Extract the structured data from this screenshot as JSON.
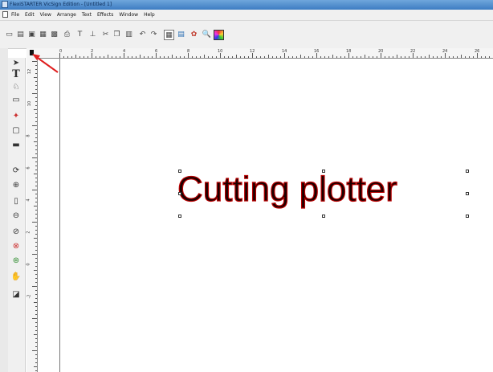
{
  "window": {
    "title": "FlexiSTARTER VicSign Edition - [Untitled 1]"
  },
  "menu": {
    "items": [
      "File",
      "Edit",
      "View",
      "Arrange",
      "Text",
      "Effects",
      "Window",
      "Help"
    ]
  },
  "toolbar": {
    "buttons": [
      "new-icon",
      "open-icon",
      "save-icon",
      "save-as-icon",
      "import-icon",
      "print-icon",
      "text-tool-icon",
      "stamp-icon",
      "cut-icon",
      "copy-icon",
      "paste-icon",
      "undo-icon",
      "redo-icon",
      "grid-icon",
      "layout-icon",
      "color-wheel-icon",
      "zoom-icon",
      "palette-icon"
    ]
  },
  "ruler": {
    "top_labels": [
      "0",
      "2",
      "4",
      "6",
      "8",
      "10",
      "12",
      "14",
      "16",
      "18",
      "20",
      "22",
      "24",
      "26",
      "28"
    ],
    "left_labels": [
      "12",
      "10",
      "8",
      "6",
      "4",
      "2",
      "0",
      "-2"
    ]
  },
  "tools": [
    "select-arrow-icon",
    "text-tool-icon",
    "shape-tool-icon",
    "rectangle-icon",
    "node-edit-icon",
    "frame-icon",
    "ruler-tool-icon",
    "rotate-view-icon",
    "zoom-in-icon",
    "zoom-page-icon",
    "zoom-out-icon",
    "zoom-previous-icon",
    "zoom-selection-icon",
    "zoom-all-icon",
    "pan-hand-icon",
    "fill-color-icon"
  ],
  "canvas": {
    "text": "Cutting plotter"
  },
  "colors": {
    "title_bar": "#3d7cc2",
    "annotation_arrow": "#e02020",
    "text_outline": "#b80000"
  }
}
